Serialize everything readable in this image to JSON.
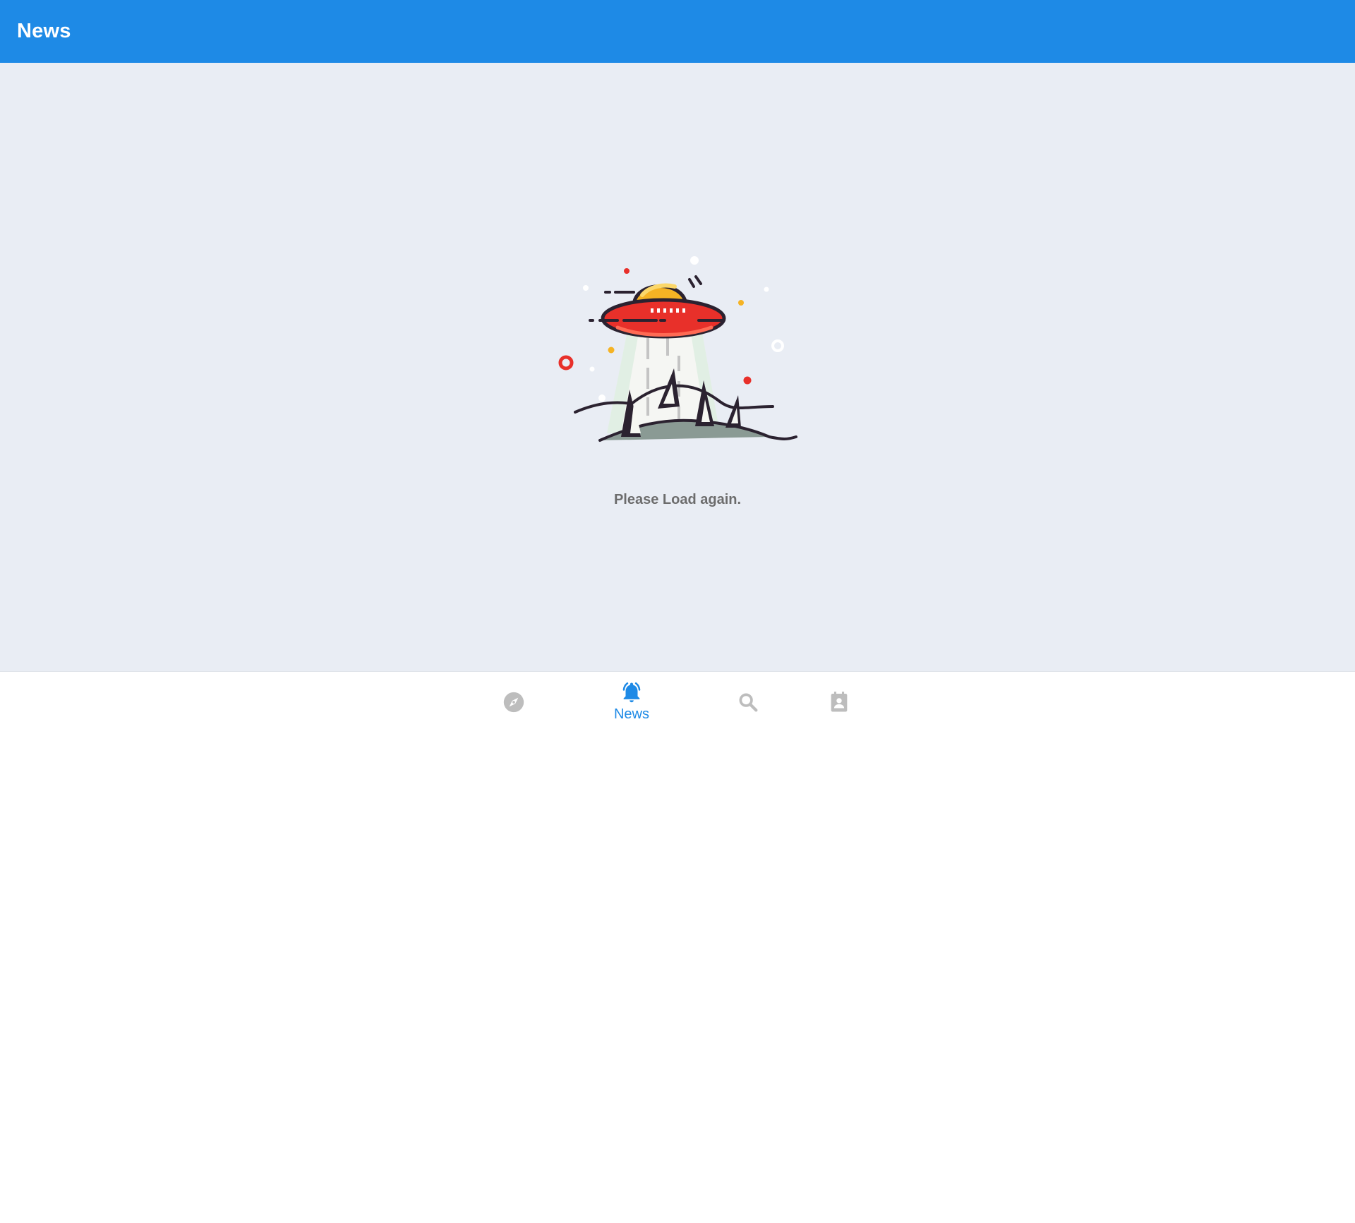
{
  "app_bar": {
    "title": "News",
    "color": "#1e8ae6"
  },
  "empty_state": {
    "illustration": "ufo-beaming-trees-illustration",
    "message": "Please Load again."
  },
  "bottom_nav": {
    "active_color": "#1e8ae6",
    "inactive_color": "#bdbdbd",
    "items": [
      {
        "icon": "compass-icon",
        "label": "",
        "active": false
      },
      {
        "icon": "bell-icon",
        "label": "News",
        "active": true
      },
      {
        "icon": "search-icon",
        "label": "",
        "active": false
      },
      {
        "icon": "contact-card-icon",
        "label": "",
        "active": false
      }
    ]
  }
}
